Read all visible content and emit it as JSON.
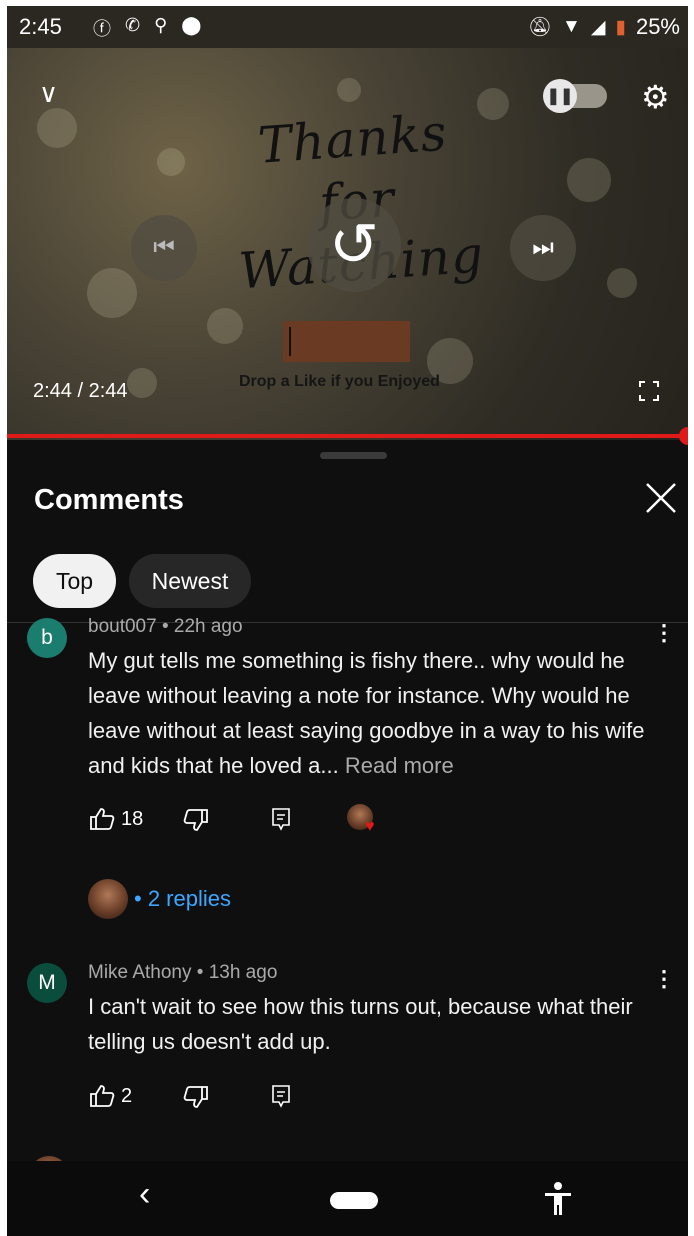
{
  "status_bar": {
    "time": "2:45",
    "battery_percent": "25%",
    "icons_left": [
      "facebook-icon",
      "wifi-calling-icon",
      "keyhole-icon",
      "location-icon"
    ],
    "icons_right": [
      "mute-icon",
      "wifi-icon",
      "signal-icon",
      "battery-icon"
    ]
  },
  "video": {
    "overlay_title": "Thanks for Watching",
    "overlay_subtitle": "Drop a Like if you Enjoyed",
    "current_time": "2:44",
    "duration": "2:44",
    "time_display": "2:44 / 2:44",
    "progress_fraction": 1.0,
    "autoplay_toggle": "paused",
    "accent_color": "#e01919"
  },
  "comments_panel": {
    "title": "Comments",
    "filters": [
      {
        "label": "Top",
        "selected": true
      },
      {
        "label": "Newest",
        "selected": false
      }
    ],
    "comments": [
      {
        "avatar_letter": "b",
        "avatar_color": "#1a7d6e",
        "meta": "bout007 • 22h ago",
        "text": "My gut tells me something is fishy there.. why would he leave without leaving a note for instance. Why would he leave without at least saying goodbye in a way to his wife and kids that he loved a...",
        "read_more": "Read more",
        "likes": "18",
        "creator_hearted": true,
        "replies_label": "• 2 replies"
      },
      {
        "avatar_letter": "M",
        "avatar_color": "#0b4d3c",
        "meta": "Mike Athony • 13h ago",
        "text": "I can't wait to see how this turns out, because what their telling us doesn't add up.",
        "likes": "2"
      }
    ]
  },
  "nav_bar": {
    "icons": [
      "back-icon",
      "home-pill",
      "accessibility-icon"
    ]
  }
}
